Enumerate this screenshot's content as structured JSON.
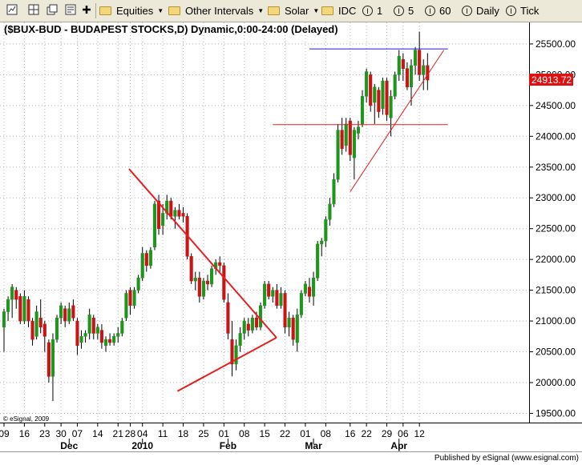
{
  "toolbar": {
    "symbol_groups_label": "Equities",
    "intervals_label": "Other Intervals",
    "template_label": "Solar",
    "feed_label": "IDC",
    "interval_buttons": [
      {
        "icon": "I",
        "label": "1"
      },
      {
        "icon": "I",
        "label": "5"
      },
      {
        "icon": "I",
        "label": "60"
      }
    ],
    "daily_label": "Daily",
    "tick_label": "Tick"
  },
  "chart": {
    "title": "($BUX-BUD - BUDAPEST STOCKS,D) Dynamic,0:00-24:00 (Delayed)",
    "copyright": "© eSignal, 2009",
    "footer": "Published by eSignal (www.esignal.com)",
    "last_price_label": "24913.72"
  },
  "chart_data": {
    "type": "candlestick",
    "ylim": [
      19350,
      25850
    ],
    "y_ticks": [
      19500,
      20000,
      20500,
      21000,
      21500,
      22000,
      22500,
      23000,
      23500,
      24000,
      24500,
      25000,
      25500
    ],
    "y_tick_labels": [
      "19500.00",
      "20000.00",
      "20500.00",
      "21000.00",
      "21500.00",
      "22000.00",
      "22500.00",
      "23000.00",
      "23500.00",
      "24000.00",
      "24500.00",
      "25000.00",
      "25500.00"
    ],
    "x_tick_labels": [
      {
        "label": "09",
        "bar": 0
      },
      {
        "label": "16",
        "bar": 5
      },
      {
        "label": "23",
        "bar": 10
      },
      {
        "label": "30",
        "bar": 14
      },
      {
        "label": "07",
        "bar": 18
      },
      {
        "label": "14",
        "bar": 23
      },
      {
        "label": "21",
        "bar": 28
      },
      {
        "label": "28",
        "bar": 31
      },
      {
        "label": "04",
        "bar": 34
      },
      {
        "label": "11",
        "bar": 39
      },
      {
        "label": "18",
        "bar": 44
      },
      {
        "label": "25",
        "bar": 49
      },
      {
        "label": "01",
        "bar": 54
      },
      {
        "label": "08",
        "bar": 59
      },
      {
        "label": "15",
        "bar": 64
      },
      {
        "label": "22",
        "bar": 69
      },
      {
        "label": "01",
        "bar": 74
      },
      {
        "label": "08",
        "bar": 79
      },
      {
        "label": "16",
        "bar": 85
      },
      {
        "label": "22",
        "bar": 89
      },
      {
        "label": "29",
        "bar": 94
      },
      {
        "label": "06",
        "bar": 98
      },
      {
        "label": "12",
        "bar": 102
      }
    ],
    "month_labels": [
      {
        "label": "Dec",
        "bar": 16
      },
      {
        "label": "2010",
        "bar": 34
      },
      {
        "label": "Feb",
        "bar": 55
      },
      {
        "label": "Mar",
        "bar": 76
      },
      {
        "label": "Apr",
        "bar": 97
      }
    ],
    "candles": [
      {
        "o": 20900,
        "h": 21200,
        "l": 20500,
        "c": 21150
      },
      {
        "o": 21150,
        "h": 21400,
        "l": 21000,
        "c": 21350
      },
      {
        "o": 21350,
        "h": 21600,
        "l": 21050,
        "c": 21550
      },
      {
        "o": 21500,
        "h": 21550,
        "l": 21200,
        "c": 21350
      },
      {
        "o": 21400,
        "h": 21450,
        "l": 20950,
        "c": 21000
      },
      {
        "o": 21000,
        "h": 21500,
        "l": 20950,
        "c": 21400
      },
      {
        "o": 21350,
        "h": 21400,
        "l": 20900,
        "c": 21000
      },
      {
        "o": 21000,
        "h": 21050,
        "l": 20600,
        "c": 20700
      },
      {
        "o": 20750,
        "h": 21250,
        "l": 20700,
        "c": 21150
      },
      {
        "o": 21050,
        "h": 21350,
        "l": 20800,
        "c": 20900
      },
      {
        "o": 20950,
        "h": 21000,
        "l": 20500,
        "c": 20750
      },
      {
        "o": 20650,
        "h": 20700,
        "l": 20000,
        "c": 20100
      },
      {
        "o": 20100,
        "h": 20800,
        "l": 19700,
        "c": 20700
      },
      {
        "o": 20700,
        "h": 21100,
        "l": 20650,
        "c": 21050
      },
      {
        "o": 21050,
        "h": 21300,
        "l": 20950,
        "c": 21250
      },
      {
        "o": 21200,
        "h": 21250,
        "l": 20900,
        "c": 21000
      },
      {
        "o": 21000,
        "h": 21300,
        "l": 20950,
        "c": 21200
      },
      {
        "o": 21250,
        "h": 21350,
        "l": 21000,
        "c": 21050
      },
      {
        "o": 21000,
        "h": 21050,
        "l": 20450,
        "c": 20600
      },
      {
        "o": 20650,
        "h": 20850,
        "l": 20550,
        "c": 20750
      },
      {
        "o": 20750,
        "h": 20850,
        "l": 20650,
        "c": 20800
      },
      {
        "o": 20800,
        "h": 21200,
        "l": 20700,
        "c": 21100
      },
      {
        "o": 21050,
        "h": 21100,
        "l": 20700,
        "c": 20800
      },
      {
        "o": 20800,
        "h": 20950,
        "l": 20700,
        "c": 20900
      },
      {
        "o": 20850,
        "h": 20950,
        "l": 20550,
        "c": 20650
      },
      {
        "o": 20600,
        "h": 20750,
        "l": 20500,
        "c": 20700
      },
      {
        "o": 20700,
        "h": 20800,
        "l": 20600,
        "c": 20650
      },
      {
        "o": 20650,
        "h": 20800,
        "l": 20600,
        "c": 20750
      },
      {
        "o": 20750,
        "h": 20900,
        "l": 20650,
        "c": 20800
      },
      {
        "o": 20800,
        "h": 21050,
        "l": 20750,
        "c": 21000
      },
      {
        "o": 21050,
        "h": 21500,
        "l": 21000,
        "c": 21450
      },
      {
        "o": 21500,
        "h": 21550,
        "l": 21100,
        "c": 21250
      },
      {
        "o": 21250,
        "h": 21550,
        "l": 21200,
        "c": 21500
      },
      {
        "o": 21500,
        "h": 21750,
        "l": 21450,
        "c": 21700
      },
      {
        "o": 21700,
        "h": 22200,
        "l": 21650,
        "c": 22100
      },
      {
        "o": 22100,
        "h": 22150,
        "l": 21800,
        "c": 21900
      },
      {
        "o": 21900,
        "h": 22200,
        "l": 21850,
        "c": 22150
      },
      {
        "o": 22200,
        "h": 22950,
        "l": 22150,
        "c": 22900
      },
      {
        "o": 22950,
        "h": 23050,
        "l": 22400,
        "c": 22500
      },
      {
        "o": 22550,
        "h": 22900,
        "l": 22400,
        "c": 22750
      },
      {
        "o": 22750,
        "h": 23050,
        "l": 22650,
        "c": 22950
      },
      {
        "o": 22950,
        "h": 23000,
        "l": 22650,
        "c": 22700
      },
      {
        "o": 22700,
        "h": 22850,
        "l": 22500,
        "c": 22800
      },
      {
        "o": 22800,
        "h": 22900,
        "l": 22650,
        "c": 22700
      },
      {
        "o": 22750,
        "h": 22850,
        "l": 22600,
        "c": 22700
      },
      {
        "o": 22700,
        "h": 22750,
        "l": 22000,
        "c": 22050
      },
      {
        "o": 22050,
        "h": 22100,
        "l": 21600,
        "c": 21650
      },
      {
        "o": 21650,
        "h": 21800,
        "l": 21500,
        "c": 21700
      },
      {
        "o": 21700,
        "h": 21800,
        "l": 21300,
        "c": 21400
      },
      {
        "o": 21400,
        "h": 21700,
        "l": 21350,
        "c": 21650
      },
      {
        "o": 21650,
        "h": 21750,
        "l": 21500,
        "c": 21600
      },
      {
        "o": 21600,
        "h": 21900,
        "l": 21550,
        "c": 21850
      },
      {
        "o": 21850,
        "h": 22000,
        "l": 21750,
        "c": 21950
      },
      {
        "o": 21950,
        "h": 22050,
        "l": 21800,
        "c": 21900
      },
      {
        "o": 21900,
        "h": 21950,
        "l": 21300,
        "c": 21350
      },
      {
        "o": 21300,
        "h": 21450,
        "l": 20700,
        "c": 20800
      },
      {
        "o": 20700,
        "h": 21000,
        "l": 20100,
        "c": 20300
      },
      {
        "o": 20300,
        "h": 20700,
        "l": 20200,
        "c": 20600
      },
      {
        "o": 20600,
        "h": 20900,
        "l": 20500,
        "c": 20800
      },
      {
        "o": 20800,
        "h": 21050,
        "l": 20700,
        "c": 21000
      },
      {
        "o": 20950,
        "h": 21050,
        "l": 20750,
        "c": 20850
      },
      {
        "o": 20850,
        "h": 21100,
        "l": 20800,
        "c": 21050
      },
      {
        "o": 21050,
        "h": 21150,
        "l": 20850,
        "c": 20900
      },
      {
        "o": 20900,
        "h": 21300,
        "l": 20850,
        "c": 21250
      },
      {
        "o": 21250,
        "h": 21650,
        "l": 21200,
        "c": 21600
      },
      {
        "o": 21600,
        "h": 21650,
        "l": 21350,
        "c": 21400
      },
      {
        "o": 21400,
        "h": 21550,
        "l": 21300,
        "c": 21500
      },
      {
        "o": 21500,
        "h": 21600,
        "l": 21200,
        "c": 21250
      },
      {
        "o": 21250,
        "h": 21550,
        "l": 21200,
        "c": 21450
      },
      {
        "o": 21450,
        "h": 21500,
        "l": 20800,
        "c": 20900
      },
      {
        "o": 20900,
        "h": 21150,
        "l": 20750,
        "c": 21050
      },
      {
        "o": 21050,
        "h": 21100,
        "l": 20600,
        "c": 20700
      },
      {
        "o": 20650,
        "h": 21200,
        "l": 20500,
        "c": 21100
      },
      {
        "o": 21100,
        "h": 21500,
        "l": 21050,
        "c": 21450
      },
      {
        "o": 21450,
        "h": 21650,
        "l": 21400,
        "c": 21600
      },
      {
        "o": 21550,
        "h": 21700,
        "l": 21300,
        "c": 21400
      },
      {
        "o": 21400,
        "h": 21800,
        "l": 21250,
        "c": 21700
      },
      {
        "o": 21700,
        "h": 22300,
        "l": 21650,
        "c": 22250
      },
      {
        "o": 22250,
        "h": 22350,
        "l": 22050,
        "c": 22300
      },
      {
        "o": 22300,
        "h": 22700,
        "l": 22200,
        "c": 22650
      },
      {
        "o": 22650,
        "h": 23000,
        "l": 22550,
        "c": 22900
      },
      {
        "o": 22900,
        "h": 23400,
        "l": 22850,
        "c": 23300
      },
      {
        "o": 23300,
        "h": 24200,
        "l": 23250,
        "c": 24100
      },
      {
        "o": 24100,
        "h": 24300,
        "l": 23700,
        "c": 23800
      },
      {
        "o": 23850,
        "h": 24300,
        "l": 23750,
        "c": 24200
      },
      {
        "o": 24250,
        "h": 24300,
        "l": 23600,
        "c": 23700
      },
      {
        "o": 23650,
        "h": 24150,
        "l": 23300,
        "c": 24100
      },
      {
        "o": 24050,
        "h": 24250,
        "l": 23950,
        "c": 24150
      },
      {
        "o": 24200,
        "h": 24750,
        "l": 24150,
        "c": 24650
      },
      {
        "o": 24650,
        "h": 25100,
        "l": 24550,
        "c": 25050
      },
      {
        "o": 25000,
        "h": 25050,
        "l": 24400,
        "c": 24500
      },
      {
        "o": 24550,
        "h": 24850,
        "l": 24200,
        "c": 24800
      },
      {
        "o": 24750,
        "h": 24800,
        "l": 24300,
        "c": 24400
      },
      {
        "o": 24450,
        "h": 24950,
        "l": 24350,
        "c": 24900
      },
      {
        "o": 24900,
        "h": 24950,
        "l": 24250,
        "c": 24350
      },
      {
        "o": 24300,
        "h": 24750,
        "l": 24000,
        "c": 24650
      },
      {
        "o": 24650,
        "h": 25050,
        "l": 24600,
        "c": 25000
      },
      {
        "o": 25000,
        "h": 25400,
        "l": 24900,
        "c": 25300
      },
      {
        "o": 25250,
        "h": 25350,
        "l": 24900,
        "c": 25100
      },
      {
        "o": 25100,
        "h": 25200,
        "l": 24750,
        "c": 24800
      },
      {
        "o": 24800,
        "h": 25250,
        "l": 24500,
        "c": 25150
      },
      {
        "o": 25150,
        "h": 25450,
        "l": 25000,
        "c": 25400
      },
      {
        "o": 25400,
        "h": 25700,
        "l": 24900,
        "c": 25000
      },
      {
        "o": 25000,
        "h": 25250,
        "l": 24750,
        "c": 25150
      },
      {
        "o": 25150,
        "h": 25350,
        "l": 24750,
        "c": 24913.72
      }
    ],
    "trendlines": [
      {
        "color": "#e61e1e",
        "width": 2,
        "x1": 30.7,
        "y1": 23470,
        "x2": 66.9,
        "y2": 20730
      },
      {
        "color": "#e61e1e",
        "width": 2,
        "x1": 42.6,
        "y1": 19860,
        "x2": 66.9,
        "y2": 20730
      },
      {
        "color": "#e61e1e",
        "width": 1,
        "x1": 85,
        "y1": 23100,
        "x2": 108,
        "y2": 25400
      },
      {
        "color": "#e61e1e",
        "width": 1,
        "x1": 66,
        "y1": 24190,
        "x2": 109,
        "y2": 24190
      },
      {
        "color": "#1e1ed2",
        "width": 1,
        "x1": 75,
        "y1": 25420,
        "x2": 109,
        "y2": 25420
      }
    ]
  }
}
